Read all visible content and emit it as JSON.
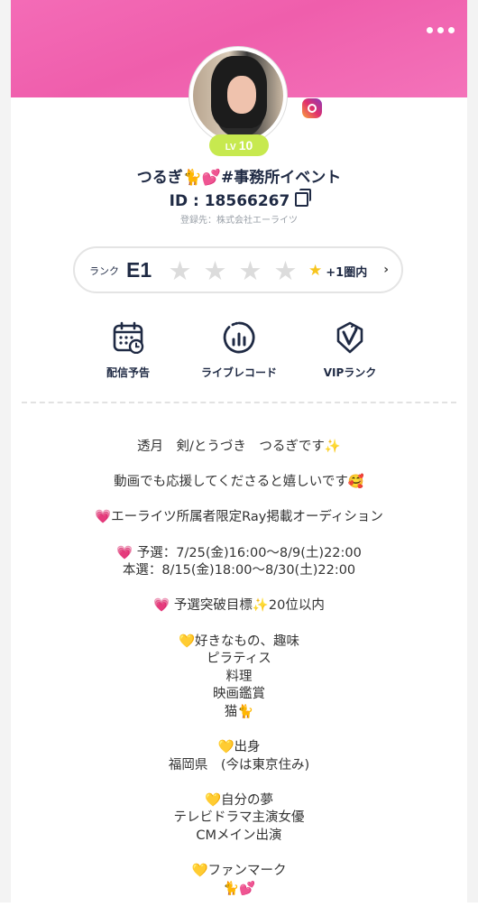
{
  "header": {
    "more_icon": "more-horizontal-icon"
  },
  "profile": {
    "level_prefix": "LV",
    "level": "10",
    "name": "つるぎ🐈💕#事務所イベント",
    "id_text": "ID : 18566267",
    "registered": "登録先：株式会社エーライツ",
    "social_icon": "instagram-icon"
  },
  "rank": {
    "label": "ランク",
    "value": "E1",
    "stars_total": 4,
    "stars_filled": 0,
    "target_text": "+1圏内",
    "target_icon": "star-icon"
  },
  "menu": {
    "items": [
      {
        "label": "配信予告",
        "icon": "calendar-clock-icon"
      },
      {
        "label": "ライブレコード",
        "icon": "bar-chart-circle-icon"
      },
      {
        "label": "VIPランク",
        "icon": "vip-badge-icon"
      }
    ]
  },
  "bio": {
    "paragraphs": [
      "透月　剣/とうづき　つるぎです✨",
      "動画でも応援してくださると嬉しいです🥰",
      "💗エーライツ所属者限定Ray掲載オーディション",
      "💗 予選：7/25(金)16:00〜8/9(土)22:00\n本選：8/15(金)18:00〜8/30(土)22:00",
      "💗 予選突破目標✨20位以内",
      "💛好きなもの、趣味\nピラティス\n料理\n映画鑑賞\n猫🐈",
      "💛出身\n福岡県　(今は東京住み)",
      "💛自分の夢\nテレビドラマ主演女優\nCMメイン出演",
      "💛ファンマーク\n🐈💕"
    ]
  },
  "colors": {
    "banner": "#f46cb7",
    "level_badge": "#c7e94f",
    "text_dark": "#1f2a44",
    "star_empty": "#dcdcdc",
    "star_gold": "#f7c51e"
  }
}
